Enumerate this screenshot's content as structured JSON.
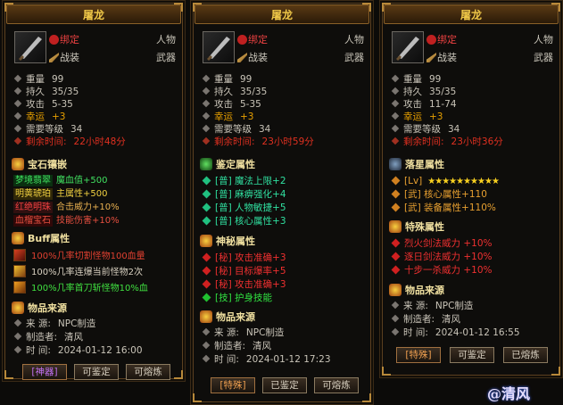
{
  "panels": [
    {
      "title": "屠龙",
      "bind": "绑定",
      "slot": "战装",
      "type": "人物",
      "kind": "武器",
      "stats": [
        [
          "重量",
          "99"
        ],
        [
          "持久",
          "35/35"
        ],
        [
          "攻击",
          "5-35"
        ],
        [
          "幸运",
          "+3"
        ],
        [
          "需要等级",
          "34"
        ],
        [
          "剩余时间:",
          "22小时48分"
        ]
      ],
      "gem_title": "宝石镶嵌",
      "gems": [
        [
          "梦境翡翠",
          "魔血值+500"
        ],
        [
          "明黄琥珀",
          "主属性+500"
        ],
        [
          "红绝明珠",
          "合击威力+10%"
        ],
        [
          "血榴宝石",
          "技能伤害+10%"
        ]
      ],
      "buff_title": "Buff属性",
      "buffs": [
        "100%几率切割怪物100血量",
        "100%几率连爆当前怪物2次",
        "100%几率首刀斩怪物10%血"
      ],
      "origin_title": "物品来源",
      "origin": [
        [
          "来  源:",
          "NPC制造"
        ],
        [
          "制造者:",
          "清风"
        ],
        [
          "时  间:",
          "2024-01-12 16:00"
        ]
      ],
      "buttons": [
        "[神器]",
        "可鉴定",
        "可熔炼"
      ]
    },
    {
      "title": "屠龙",
      "bind": "绑定",
      "slot": "战装",
      "type": "人物",
      "kind": "武器",
      "stats": [
        [
          "重量",
          "99"
        ],
        [
          "持久",
          "35/35"
        ],
        [
          "攻击",
          "5-35"
        ],
        [
          "幸运",
          "+3"
        ],
        [
          "需要等级",
          "34"
        ],
        [
          "剩余时间:",
          "23小时59分"
        ]
      ],
      "ident_title": "鉴定属性",
      "ident": [
        "[普] 魔法上限+2",
        "[普] 麻痹强化+4",
        "[普] 人物敏捷+5",
        "[普] 核心属性+3"
      ],
      "myst_title": "神秘属性",
      "myst": [
        "[秘] 攻击准确+3",
        "[秘] 目标爆率+5",
        "[秘] 攻击准确+3",
        "[技] 护身技能"
      ],
      "origin_title": "物品来源",
      "origin": [
        [
          "来  源:",
          "NPC制造"
        ],
        [
          "制造者:",
          "清风"
        ],
        [
          "时  间:",
          "2024-01-12 17:23"
        ]
      ],
      "buttons": [
        "[特殊]",
        "已鉴定",
        "可熔炼"
      ]
    },
    {
      "title": "屠龙",
      "bind": "绑定",
      "slot": "战装",
      "type": "人物",
      "kind": "武器",
      "stats": [
        [
          "重量",
          "99"
        ],
        [
          "持久",
          "35/35"
        ],
        [
          "攻击",
          "11-74"
        ],
        [
          "幸运",
          "+3"
        ],
        [
          "需要等级",
          "34"
        ],
        [
          "剩余时间:",
          "23小时36分"
        ]
      ],
      "star_title": "落星属性",
      "star_lv": "[Lv]",
      "star_count": 10,
      "star_attrs": [
        "[武] 核心属性+110",
        "[武] 装备属性+110%"
      ],
      "special_title": "特殊属性",
      "special": [
        "烈火剑法威力 +10%",
        "逐日剑法威力 +10%",
        "十步一杀威力 +10%"
      ],
      "origin_title": "物品来源",
      "origin": [
        [
          "来  源:",
          "NPC制造"
        ],
        [
          "制造者:",
          "清风"
        ],
        [
          "时  间:",
          "2024-01-12 16:55"
        ]
      ],
      "buttons": [
        "[特殊]",
        "可鉴定",
        "已熔炼"
      ]
    }
  ],
  "watermark": "@清风",
  "colors": {
    "gold": "#f0c848",
    "red": "#e03020",
    "green": "#20d040",
    "cyan": "#40e0a0",
    "lucky": "#e8a000"
  }
}
